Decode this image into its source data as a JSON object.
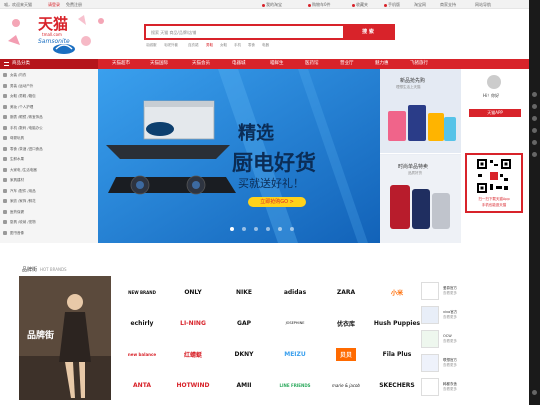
{
  "topbar": {
    "greeting": "喵，欢迎来天猫",
    "login": "请登录",
    "register": "免费注册",
    "links": [
      "我的淘宝",
      "购物车0件",
      "收藏夹",
      "手机版",
      "淘宝网",
      "商家支持",
      "网站导航"
    ]
  },
  "header": {
    "logo_text": "天猫",
    "logo_sub": "tmall.com",
    "logo_brand": "Samsonite"
  },
  "search": {
    "placeholder": "搜索 天猫 商品/品牌/店铺",
    "button": "搜 索"
  },
  "hot_words": [
    "羽绒服",
    "毛呢外套",
    "连衣裙",
    "男鞋",
    "女鞋",
    "手机",
    "零食",
    "电器"
  ],
  "nav": {
    "category_label": "商品分类",
    "items": [
      "天猫超市",
      "天猫国际",
      "天猫会员",
      "电器城",
      "喵鲜生",
      "医药馆",
      "营业厅",
      "魅力惠",
      "飞猪旅行"
    ]
  },
  "categories": [
    "女装 /内衣",
    "男装 /运动户外",
    "女鞋 /男鞋 /箱包",
    "美妆 /个人护理",
    "腕表 /眼镜 /珠宝饰品",
    "手机 /数码 /电脑办公",
    "母婴玩具",
    "零食 /茶酒 /进口食品",
    "生鲜水果",
    "大家电 /生活电器",
    "家具建材",
    "汽车 /配件 /用品",
    "家纺 /家饰 /鲜花",
    "医药保健",
    "厨具 /收纳 /宠物",
    "图书音像"
  ],
  "banner": {
    "headline_1": "精选",
    "headline_2": "厨电好货",
    "sub": "买就送好礼！",
    "cta": "立即抢购GO >"
  },
  "promo": {
    "p1_title": "新品抢先购",
    "p1_sub": "理想生活上天猫",
    "p2_title": "时尚单品特卖",
    "p2_sub": "品质好货"
  },
  "account": {
    "greeting": "Hi！你好",
    "app_label": "天猫APP",
    "qr_title": "扫一扫下载天猫App",
    "qr_sub": "手机也能逛天猫"
  },
  "brands": {
    "section_title": "品牌街",
    "section_en": "HOT BRANDS",
    "promo_label": "品牌街",
    "grid": [
      [
        "NEW BRAND",
        "ONLY",
        "NIKE",
        "adidas",
        "ZARA",
        "小米"
      ],
      [
        "echirly",
        "LI-NING",
        "GAP",
        "JOSEPHINE",
        "优衣库",
        "Hush Puppies"
      ],
      [
        "new balance",
        "红蜻蜓",
        "DKNY",
        "MEIZU",
        "贝贝",
        "Fila Plus"
      ],
      [
        "ANTA",
        "HOTWIND",
        "AMII",
        "LINE FRIENDS",
        "marie & jacob",
        "SKECHERS"
      ]
    ],
    "right_list": [
      {
        "title": "爱慕官方",
        "sub": "查看更多"
      },
      {
        "title": "vivo官方",
        "sub": "查看更多"
      },
      {
        "title": "OCW",
        "sub": "查看更多"
      },
      {
        "title": "联想官方",
        "sub": "查看更多"
      },
      {
        "title": "韩都衣舍",
        "sub": "查看更多"
      }
    ]
  },
  "colors": {
    "accent": "#d8232a",
    "nav_dark": "#b5151b",
    "banner_blue": "#1e82d3"
  }
}
